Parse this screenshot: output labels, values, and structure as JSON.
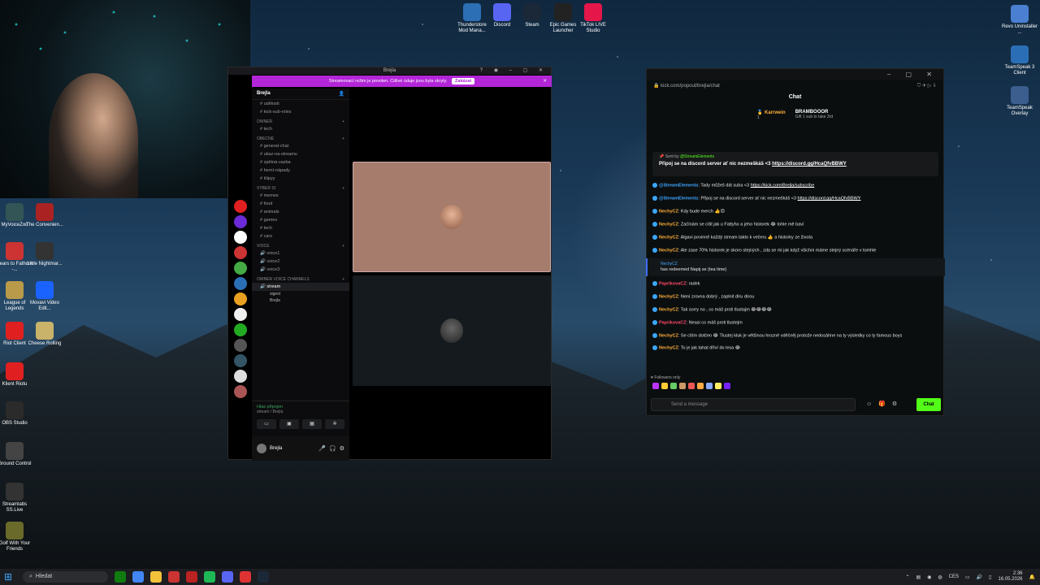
{
  "desktop": {
    "top_icons": [
      {
        "label": "Thunderstore Mod Mana...",
        "icon": "thunderstore-icon",
        "color": "#2c6fb5"
      },
      {
        "label": "Discord",
        "icon": "discord-icon",
        "color": "#5865f2"
      },
      {
        "label": "Steam",
        "icon": "steam-icon",
        "color": "#1b2838"
      },
      {
        "label": "Epic Games Launcher",
        "icon": "epic-icon",
        "color": "#222222"
      },
      {
        "label": "TikTok LIVE Studio",
        "icon": "tiktok-icon",
        "color": "#e4164a"
      }
    ],
    "right_icons": [
      {
        "label": "Revo Uninstaller ...",
        "icon": "revo-icon",
        "color": "#4a7fd1"
      },
      {
        "label": "TeamSpeak 3 Client",
        "icon": "teamspeak-icon",
        "color": "#2a6fb6"
      },
      {
        "label": "TeamSpeak Overlay",
        "icon": "teamspeak-overlay-icon",
        "color": "#3b5e8f"
      }
    ],
    "left_icons": [
      {
        "label": "MyVoiceZoo",
        "icon": "myvoicezoo-icon",
        "color": "#355"
      },
      {
        "label": "The Convenien...",
        "icon": "convenience-icon",
        "color": "#a22"
      },
      {
        "label": "Fears to Fathom -...",
        "icon": "f2f-icon",
        "color": "#c33"
      },
      {
        "label": "Little Nightmar...",
        "icon": "nightmares-icon",
        "color": "#333"
      },
      {
        "label": "League of Legends",
        "icon": "lol-icon",
        "color": "#b89a4a"
      },
      {
        "label": "Movavi Video Edit...",
        "icon": "movavi-icon",
        "color": "#1b63ff"
      },
      {
        "label": "Riot Client",
        "icon": "riot-icon",
        "color": "#e02020"
      },
      {
        "label": "Cheese Rolling",
        "icon": "cheese-icon",
        "color": "#c9b36a"
      },
      {
        "label": "Klient Riotu",
        "icon": "riot-client-icon",
        "color": "#e02020"
      },
      {
        "label": "OBS Studio",
        "icon": "obs-icon",
        "color": "#2b2b2b"
      },
      {
        "label": "Ground Control",
        "icon": "ground-control-icon",
        "color": "#444"
      },
      {
        "label": "Streamlabs SS.Live",
        "icon": "streamlabs-icon",
        "color": "#333"
      },
      {
        "label": "Golf With Your Friends",
        "icon": "golf-icon",
        "color": "#6a6a2a"
      }
    ]
  },
  "discord": {
    "window_title": "Brejla",
    "banner_text": "Streamovací režim je povolen. Citlivé údaje jsou byla skryty.",
    "banner_button": "Zakázat",
    "server_name": "Brejla",
    "channels": [
      {
        "type": "text",
        "name": "udělosti"
      },
      {
        "type": "text",
        "name": "kick-sub-roles"
      },
      {
        "type": "category",
        "name": "OWNER"
      },
      {
        "type": "text",
        "name": "tech"
      },
      {
        "type": "category",
        "name": "OBECNÉ"
      },
      {
        "type": "text",
        "name": "general-chat"
      },
      {
        "type": "text",
        "name": "ukaz-na-streamu"
      },
      {
        "type": "text",
        "name": "zpětná-vazba"
      },
      {
        "type": "text",
        "name": "herní-nápady"
      },
      {
        "type": "text",
        "name": "klipyy"
      },
      {
        "type": "category",
        "name": "VYBER SI"
      },
      {
        "type": "text",
        "name": "memes"
      },
      {
        "type": "text",
        "name": "food"
      },
      {
        "type": "text",
        "name": "animals"
      },
      {
        "type": "text",
        "name": "games"
      },
      {
        "type": "text",
        "name": "tech"
      },
      {
        "type": "text",
        "name": "cars"
      },
      {
        "type": "category",
        "name": "VOICE"
      },
      {
        "type": "voice",
        "name": "voice1"
      },
      {
        "type": "voice",
        "name": "voice2"
      },
      {
        "type": "voice",
        "name": "voice3"
      },
      {
        "type": "category",
        "name": "OWNER VOICE CHANNELS"
      },
      {
        "type": "voice",
        "name": "stream"
      }
    ],
    "voice_users": [
      "sigest",
      "Brejla"
    ],
    "voice_status": "Hlas připojen",
    "voice_sub": "stream / Brejla",
    "user_name": "Brejla"
  },
  "kick": {
    "url": "kick.com/popout/brejla/chat",
    "title": "Chat",
    "gift1_name": "Karrwein",
    "gift1_count": "1",
    "gift2_name": "BRAMBOOOR",
    "gift2_sub": "Gift 1 sub to take 3rd",
    "pinned_from_label": "Sent by",
    "pinned_from_user": "@StreamElements",
    "pinned_text": "Připoj se na discord server ať nic nezmeškáš <3",
    "pinned_link": "https://discord.gg/HcaQfvBBWY",
    "messages": [
      {
        "user": "@StreamElements",
        "cls": "u-se",
        "text": ": Tady můžeš dát suba <3 ",
        "link": "https://kick.com/Brejla/subscribe"
      },
      {
        "user": "@StreamElements",
        "cls": "u-se",
        "text": ": Připoj se na discord server ať nic nezmeškáš <3 ",
        "link": "https://discord.gg/HcaQfvBBWY"
      },
      {
        "user": "NechyCZ",
        "cls": "u-nc",
        "text": ": Kdy bude merch 👍😊",
        "link": ""
      },
      {
        "user": "NechyCZ",
        "cls": "u-nc",
        "text": ": Začínám se cítit jak u Fattyho a jeho historek 😂 tohle mě baví",
        "link": ""
      },
      {
        "user": "NechyCZ",
        "cls": "u-nc",
        "text": ": Algavi povinně každý stream takto k večeru 👍 a historky ze života",
        "link": ""
      },
      {
        "user": "NechyCZ",
        "cls": "u-nc",
        "text": ": Ale zase 70% historek je skoro stejných , zda se mi jak když všichni máme stejný scénáře v tomhle",
        "link": ""
      }
    ],
    "redeem_user": "NechyCZ",
    "redeem_text": "has redeemed Napij se (tea time)",
    "messages2": [
      {
        "user": "PaprikovaCZ",
        "cls": "u-pp",
        "text": ": radek",
        "link": ""
      },
      {
        "user": "NechyCZ",
        "cls": "u-nc",
        "text": ": Není zrovna dobrý , zaplnit díru dírou",
        "link": ""
      },
      {
        "user": "NechyCZ",
        "cls": "u-nc",
        "text": ": Tak sorry no , co máš proti tlustajm 😂😂😂😂",
        "link": ""
      },
      {
        "user": "PaprikovaCZ",
        "cls": "u-pp",
        "text": ": Neasi co máš proti tlustejm",
        "link": ""
      },
      {
        "user": "NechyCZ",
        "cls": "u-nc",
        "text": ": Se cítím dotčen 😂 Tlustej kluk je většinou hrozně vděčněj protože nedosáhne na ty výsledky co ty famous boys",
        "link": ""
      },
      {
        "user": "NechyCZ",
        "cls": "u-nc",
        "text": ": To je jak tahat dříví do lesa 😂",
        "link": ""
      }
    ],
    "followers_only": "Followers only",
    "input_placeholder": "Send a message",
    "send_label": "Chat"
  },
  "taskbar": {
    "search_placeholder": "Hledat",
    "lang": "CES",
    "time": "2:36",
    "date": "16.05.2026"
  },
  "colors": {
    "kick_green": "#53fc18",
    "discord_banner": "#b326d8"
  }
}
